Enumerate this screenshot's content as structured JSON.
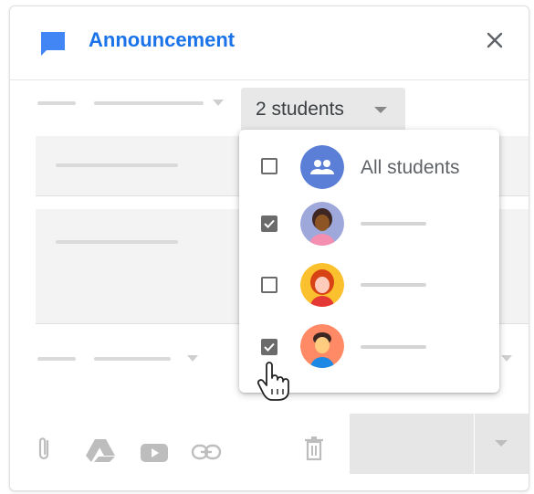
{
  "header": {
    "title": "Announcement",
    "title_color": "#1a73e8",
    "icon": "announcement-icon",
    "close_icon": "close-icon"
  },
  "recipients": {
    "button_label": "2 students",
    "dropdown": {
      "all_label": "All students",
      "items": [
        {
          "label": "All students",
          "checked": false,
          "avatar": "group-icon"
        },
        {
          "checked": true,
          "avatar": "student-avatar-1"
        },
        {
          "checked": false,
          "avatar": "student-avatar-2"
        },
        {
          "checked": true,
          "avatar": "student-avatar-3"
        }
      ]
    }
  },
  "toolbar": {
    "icons": [
      "attach-icon",
      "drive-icon",
      "youtube-icon",
      "link-icon",
      "trash-icon"
    ]
  },
  "colors": {
    "accent": "#1a73e8",
    "checkbox": "#6b6b6b"
  }
}
